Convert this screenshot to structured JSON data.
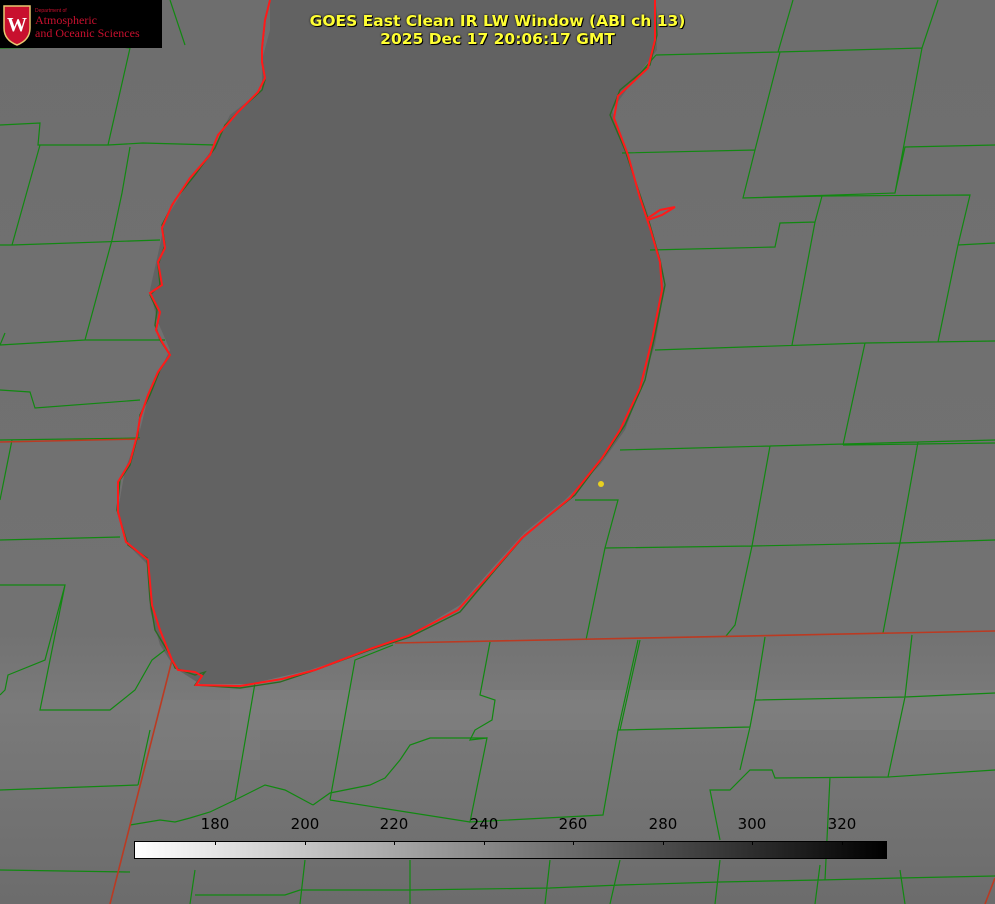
{
  "logo": {
    "department": "Department of",
    "line1": "Atmospheric",
    "line2": "and Oceanic Sciences",
    "crest_letter": "W"
  },
  "title": {
    "line1": "GOES East Clean IR LW Window (ABI ch 13)",
    "line2": "2025 Dec 17 20:06:17 GMT"
  },
  "colorbar": {
    "ticks": [
      "180",
      "200",
      "220",
      "240",
      "260",
      "280",
      "300",
      "320"
    ],
    "from_color": "#ffffff",
    "to_color": "#000000"
  },
  "colors": {
    "lake_outline": "#ff1a1a",
    "county_lines": "#118811",
    "state_lines": "#cc3322",
    "title_text": "#ffff33",
    "marker": "#e8d020",
    "logo_red": "#c8102e"
  }
}
